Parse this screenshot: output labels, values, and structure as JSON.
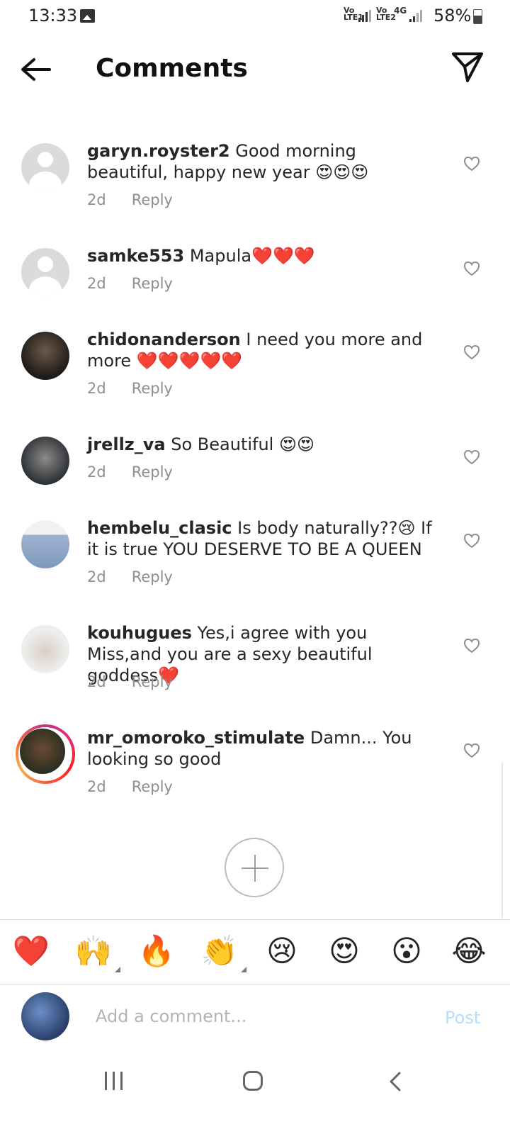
{
  "status_bar": {
    "time": "13:33",
    "network1": "Vo LTE1",
    "network2": "Vo LTE2",
    "network_type": "4G",
    "battery": "58%"
  },
  "header": {
    "title": "Comments",
    "back_icon": "arrow-left-icon",
    "share_icon": "paper-plane-icon"
  },
  "comments": [
    {
      "user": "garyn.royster2",
      "text": "Good morning beautiful, happy new year 😍😍😍",
      "time": "2d",
      "reply": "Reply"
    },
    {
      "user": "samke553",
      "text": "Mapula❤️❤️❤️",
      "time": "2d",
      "reply": "Reply"
    },
    {
      "user": "chidonanderson",
      "text": "I need you more and more ❤️❤️❤️❤️❤️",
      "time": "2d",
      "reply": "Reply"
    },
    {
      "user": "jrellz_va",
      "text": "So Beautiful 😍😍",
      "time": "2d",
      "reply": "Reply"
    },
    {
      "user": "hembelu_clasic",
      "text": "Is body naturally??😢 If it is true YOU DESERVE TO BE A QUEEN",
      "time": "2d",
      "reply": "Reply"
    },
    {
      "user": "kouhugues",
      "text": "Yes,i agree with you Miss,and you are a sexy beautiful goddess❤️",
      "time": "2d",
      "reply": "Reply"
    },
    {
      "user": "mr_omoroko_stimulate",
      "text": "Damn... You looking so good",
      "time": "2d",
      "reply": "Reply"
    }
  ],
  "quick_reactions": [
    "❤️",
    "🙌",
    "🔥",
    "👏",
    "😢",
    "😍",
    "😮",
    "😂"
  ],
  "composer": {
    "placeholder": "Add a comment...",
    "post_label": "Post"
  },
  "colors": {
    "post_disabled": "#b2dffc",
    "heart_outline": "#8e8e8e",
    "story_ring": "#e1306c"
  }
}
